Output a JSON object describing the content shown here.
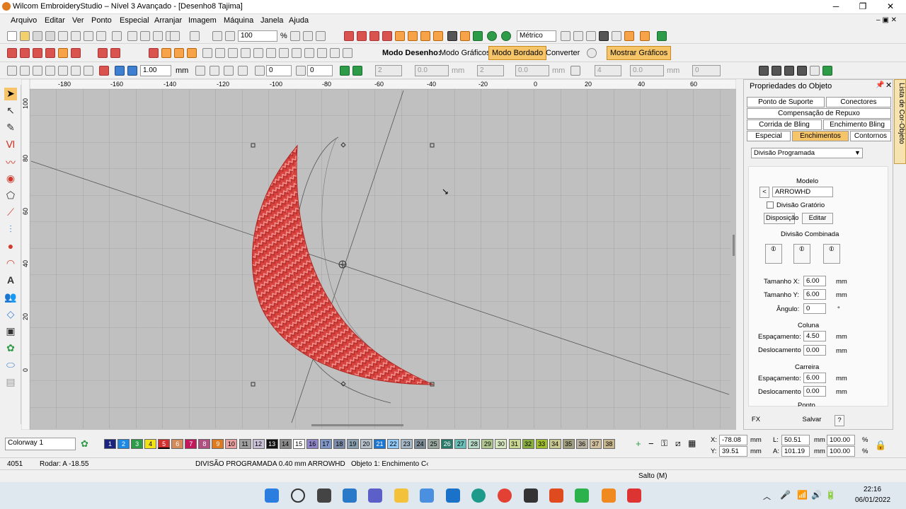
{
  "window": {
    "title": "Wilcom EmbroideryStudio – Nível 3 Avançado - [Desenho8       Tajima]",
    "controls": [
      "─",
      "❐",
      "✕"
    ]
  },
  "menu": [
    "Arquivo",
    "Editar",
    "Ver",
    "Ponto",
    "Especial",
    "Arranjar",
    "Imagem",
    "Máquina",
    "Janela",
    "Ajuda"
  ],
  "toolbar1": {
    "zoom": "100",
    "zoom_unit": "%",
    "units": "Métrico"
  },
  "toolbar2": {
    "mode_label": "Modo Desenho:",
    "graphics_mode": "Modo Gráficos",
    "embroidery_mode": "Modo Bordado",
    "convert": "Converter",
    "show_graphics": "Mostrar Gráficos"
  },
  "toolbar3": {
    "line_width": "1.00",
    "line_unit": "mm",
    "rotate": "0",
    "slant": "0",
    "f1": "2",
    "f2": "0.0",
    "u1": "mm",
    "f3": "2",
    "f4": "0.0",
    "u2": "mm",
    "f5": "4",
    "f6": "0.0",
    "u3": "mm",
    "f7": "0"
  },
  "ruler": {
    "h": [
      "-180",
      "-160",
      "-140",
      "-120",
      "-100",
      "-80",
      "-60",
      "-40",
      "-20",
      "0",
      "20",
      "40",
      "60"
    ],
    "v": [
      "100",
      "80",
      "60",
      "40",
      "20",
      "0"
    ]
  },
  "panel": {
    "title": "Propriedades do Objeto",
    "tabs_row1": [
      "Ponto de Suporte",
      "Conectores"
    ],
    "tabs_row2": [
      "Compensação de Repuxo"
    ],
    "tabs_row3": [
      "Corrida de Bling",
      "Enchimento Bling"
    ],
    "tabs_row4": [
      "Especial",
      "Enchimentos",
      "Contornos"
    ],
    "fill_type": "Divisão Programada",
    "model_label": "Modelo",
    "model_value": "ARROWHD",
    "gratorio_label": "Divisão Gratório",
    "disposicao": "Disposição",
    "editar": "Editar",
    "combined_label": "Divisão Combinada",
    "size_x_label": "Tamanho X:",
    "size_x": "6.00",
    "size_x_unit": "mm",
    "size_y_label": "Tamanho Y:",
    "size_y": "6.00",
    "size_y_unit": "mm",
    "angle_label": "Ângulo:",
    "angle": "0",
    "angle_unit": "°",
    "coluna_label": "Coluna",
    "col_spacing_label": "Espaçamento:",
    "col_spacing": "4.50",
    "col_spacing_unit": "mm",
    "col_offset_label": "Deslocamento",
    "col_offset": "0.00",
    "col_offset_unit": "mm",
    "carreira_label": "Carreira",
    "row_spacing_label": "Espaçamento:",
    "row_spacing": "6.00",
    "row_spacing_unit": "mm",
    "row_offset_label": "Deslocamento",
    "row_offset": "0.00",
    "row_offset_unit": "mm",
    "ponto_label": "Ponto",
    "fx": "FX",
    "save": "Salvar",
    "help": "?",
    "side_tab": "Lista de Cor-Objeto"
  },
  "colorway": {
    "name": "Colorway 1",
    "swatches": [
      {
        "n": "1",
        "c": "#1a237e",
        "t": "#fff"
      },
      {
        "n": "2",
        "c": "#1e88e5",
        "t": "#fff"
      },
      {
        "n": "3",
        "c": "#2e9b48",
        "t": "#fff"
      },
      {
        "n": "4",
        "c": "#f2e21a",
        "t": "#000"
      },
      {
        "n": "5",
        "c": "#d32f2f",
        "t": "#fff"
      },
      {
        "n": "6",
        "c": "#d48a5a",
        "t": "#fff"
      },
      {
        "n": "7",
        "c": "#c2185b",
        "t": "#fff"
      },
      {
        "n": "8",
        "c": "#b05080",
        "t": "#fff"
      },
      {
        "n": "9",
        "c": "#e07a1f",
        "t": "#fff"
      },
      {
        "n": "10",
        "c": "#e8a0a0",
        "t": "#000"
      },
      {
        "n": "11",
        "c": "#a0a0a0",
        "t": "#000"
      },
      {
        "n": "12",
        "c": "#c9c0d8",
        "t": "#000"
      },
      {
        "n": "13",
        "c": "#111111",
        "t": "#fff"
      },
      {
        "n": "14",
        "c": "#8a8a8a",
        "t": "#000"
      },
      {
        "n": "15",
        "c": "#ffffff",
        "t": "#000"
      },
      {
        "n": "16",
        "c": "#8e86c8",
        "t": "#000"
      },
      {
        "n": "17",
        "c": "#7f96c6",
        "t": "#000"
      },
      {
        "n": "18",
        "c": "#7a8aa8",
        "t": "#000"
      },
      {
        "n": "19",
        "c": "#8aa0b0",
        "t": "#000"
      },
      {
        "n": "20",
        "c": "#b7c2cc",
        "t": "#000"
      },
      {
        "n": "21",
        "c": "#1976d2",
        "t": "#fff"
      },
      {
        "n": "22",
        "c": "#90caf9",
        "t": "#000"
      },
      {
        "n": "23",
        "c": "#a6b8c8",
        "t": "#000"
      },
      {
        "n": "24",
        "c": "#7d8c96",
        "t": "#000"
      },
      {
        "n": "25",
        "c": "#9aa8a0",
        "t": "#000"
      },
      {
        "n": "26",
        "c": "#2a7a6a",
        "t": "#fff"
      },
      {
        "n": "27",
        "c": "#6ac0b8",
        "t": "#000"
      },
      {
        "n": "28",
        "c": "#b8d8c8",
        "t": "#000"
      },
      {
        "n": "29",
        "c": "#b0c890",
        "t": "#000"
      },
      {
        "n": "30",
        "c": "#d8e8c0",
        "t": "#000"
      },
      {
        "n": "31",
        "c": "#c8d890",
        "t": "#000"
      },
      {
        "n": "32",
        "c": "#8ab040",
        "t": "#000"
      },
      {
        "n": "33",
        "c": "#a0c030",
        "t": "#000"
      },
      {
        "n": "34",
        "c": "#c8c890",
        "t": "#000"
      },
      {
        "n": "35",
        "c": "#a0a080",
        "t": "#000"
      },
      {
        "n": "36",
        "c": "#b8b0a0",
        "t": "#000"
      },
      {
        "n": "37",
        "c": "#d0c0a0",
        "t": "#000"
      },
      {
        "n": "38",
        "c": "#c8b890",
        "t": "#000"
      }
    ]
  },
  "coords": {
    "x_label": "X:",
    "x": "-78.08",
    "x_unit": "mm",
    "y_label": "Y:",
    "y": "39.51",
    "y_unit": "mm",
    "l_label": "L:",
    "l": "50.51",
    "l_unit": "mm",
    "l_pct": "100.00",
    "l_pct_unit": "%",
    "a_label": "A:",
    "a": "101.19",
    "a_unit": "mm",
    "a_pct": "100.00",
    "a_pct_unit": "%"
  },
  "status": {
    "stitches": "4051",
    "rotate": "Rodar: A -18.55",
    "fill_desc": "DIVISÃO PROGRAMADA  0.40 mm ARROWHD",
    "object": "Objeto 1: Enchimento C‹",
    "jump": "Salto (M)"
  },
  "taskbar": {
    "time": "22:16",
    "date": "06/01/2022"
  }
}
